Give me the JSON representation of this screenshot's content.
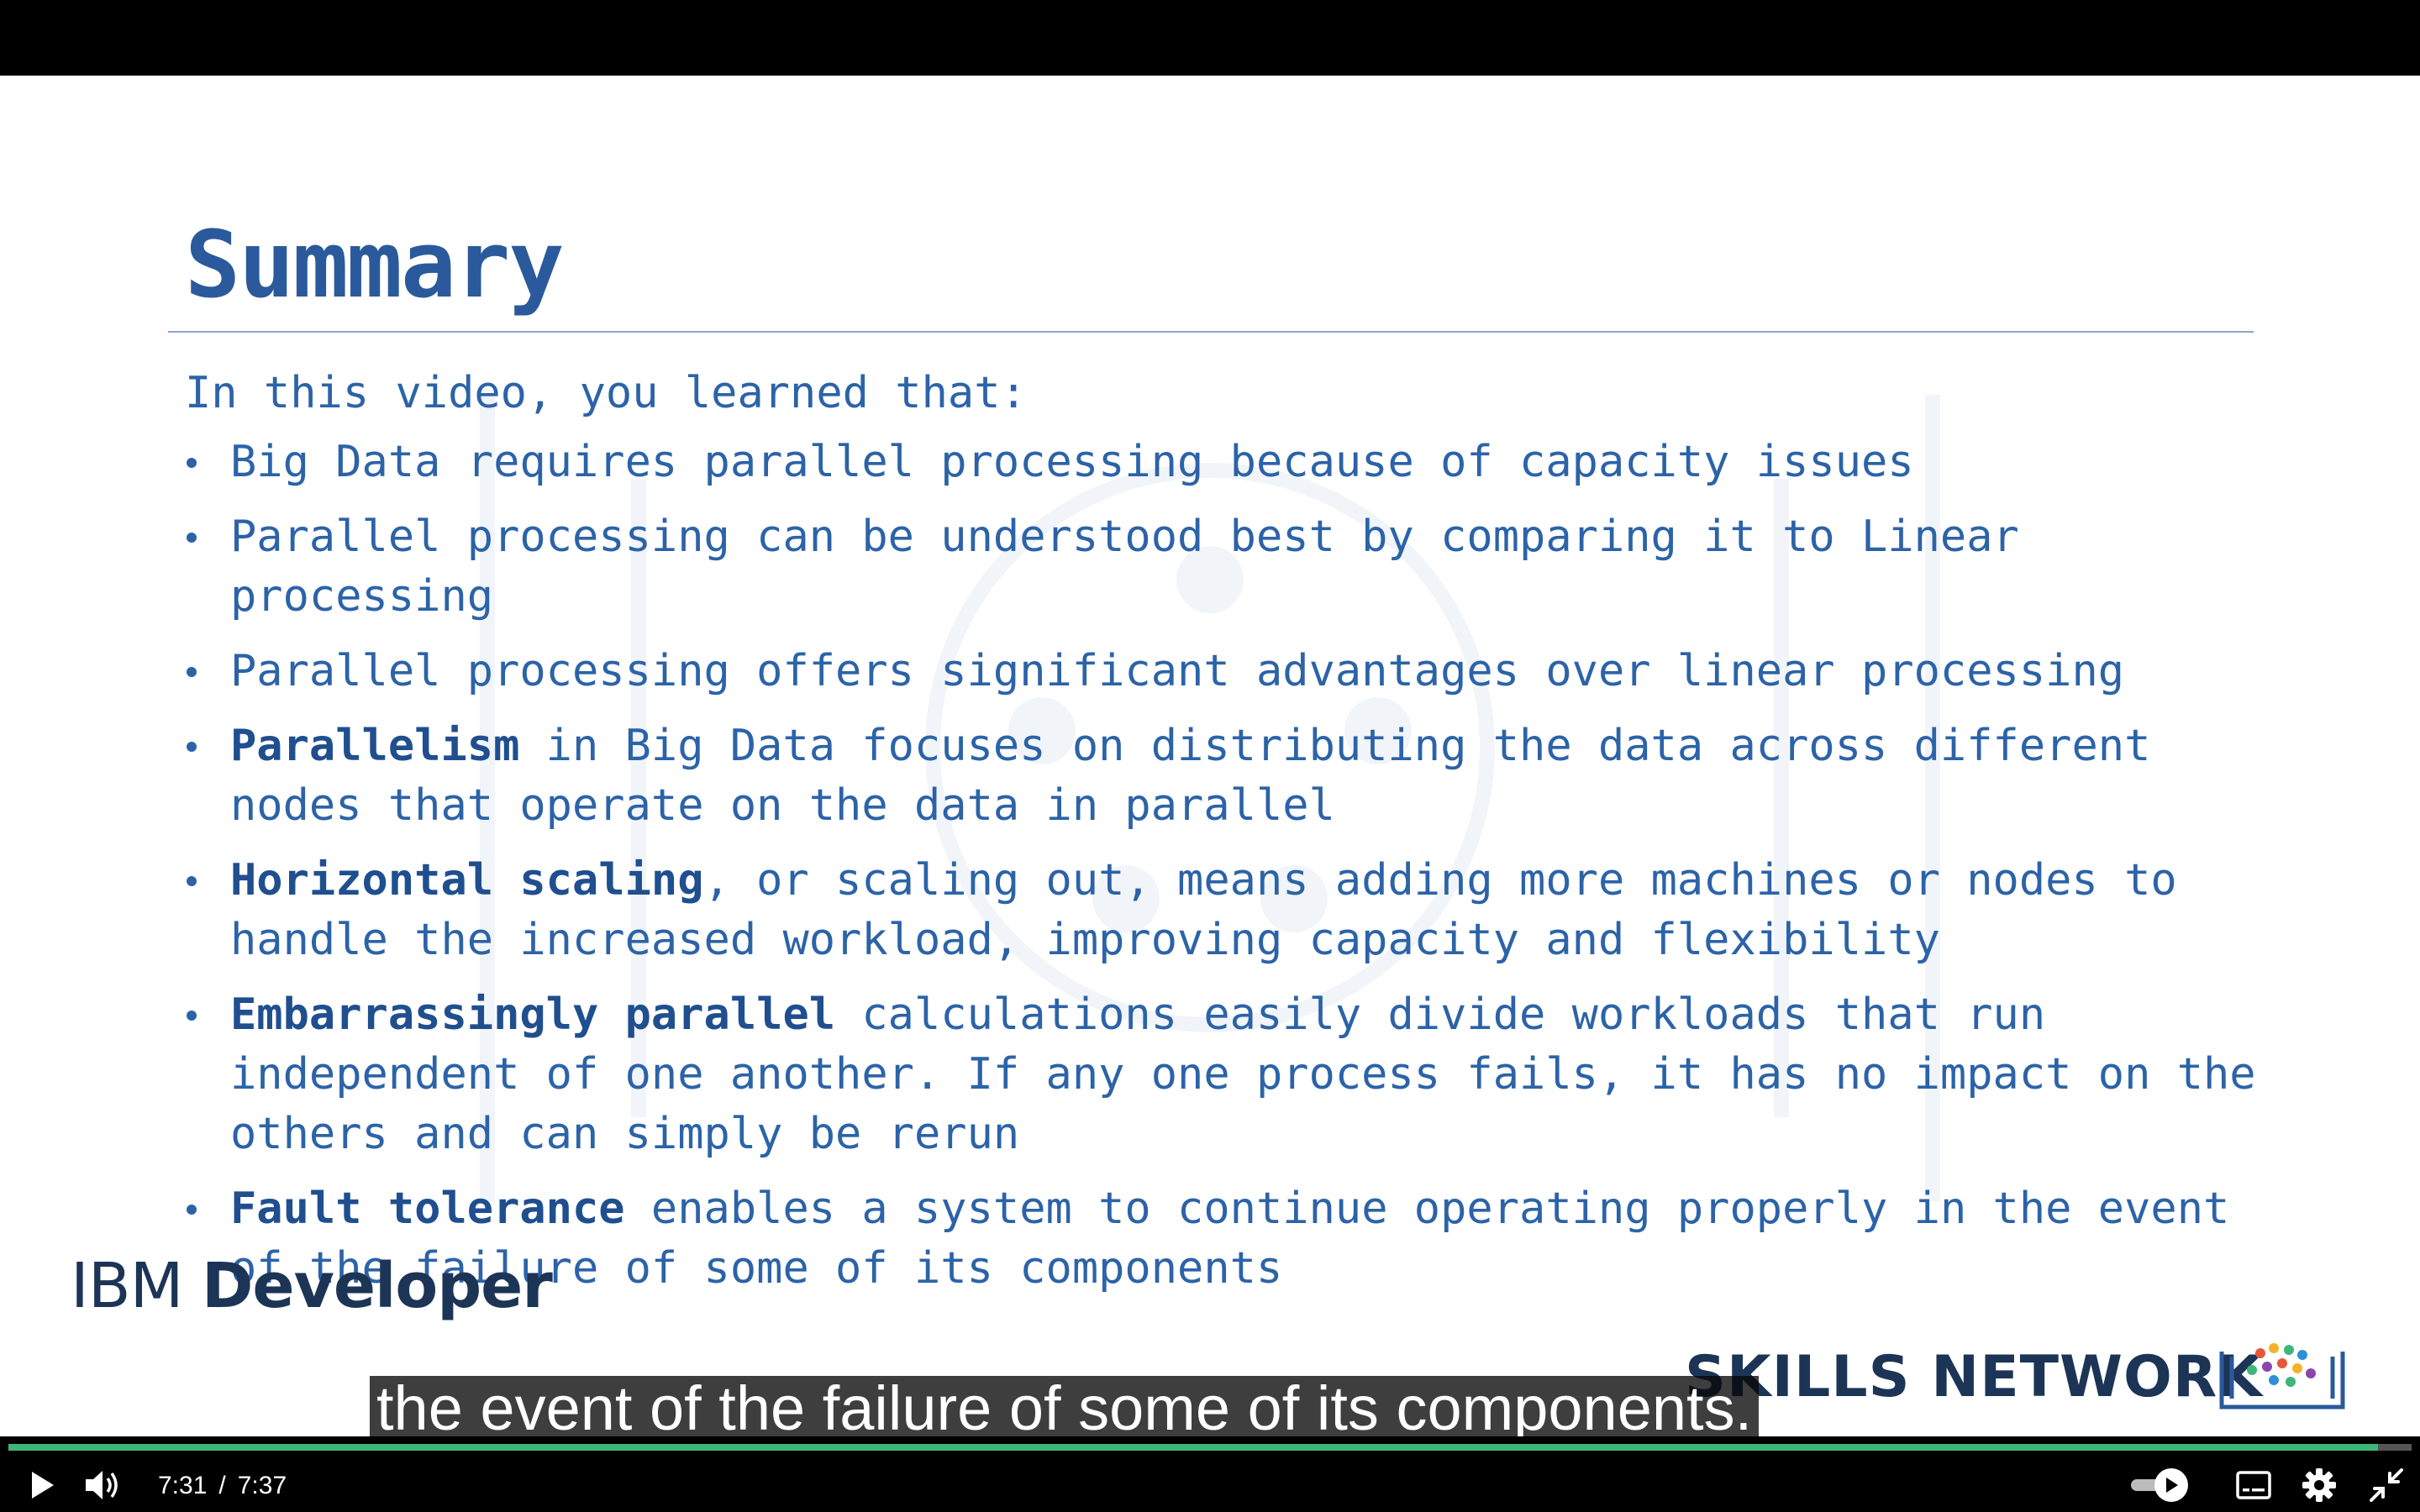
{
  "slide": {
    "title": "Summary",
    "intro": "In this video, you learned that:",
    "bullets": [
      {
        "bold": "",
        "text": "Big Data requires parallel processing because of capacity issues"
      },
      {
        "bold": "",
        "text": "Parallel processing can be understood best by comparing it to Linear processing"
      },
      {
        "bold": "",
        "text": "Parallel processing offers significant advantages over linear processing"
      },
      {
        "bold": "Parallelism",
        "text": " in Big Data focuses on distributing the data across different nodes that operate on the data in parallel"
      },
      {
        "bold": "Horizontal scaling",
        "text": ", or scaling out, means adding more machines or nodes to handle the increased workload, improving capacity and flexibility"
      },
      {
        "bold": "Embarrassingly parallel",
        "text": " calculations easily divide workloads that run independent of one another. If any one process fails, it has no impact on the others and can simply be rerun"
      },
      {
        "bold": "Fault tolerance",
        "text": " enables a system to continue operating properly in the event of the failure of some of its components"
      }
    ],
    "footer_left_light": "IBM ",
    "footer_left_bold": "Developer",
    "footer_right": "SKILLS NETWORK"
  },
  "caption": "the event of the failure of some of its components.",
  "player": {
    "current_time": "7:31",
    "separator": "/",
    "duration": "7:37",
    "progress_fraction": 0.986,
    "autoplay_on": true,
    "colors": {
      "progress": "#3fb57a",
      "title": "#2a5a9b",
      "text": "#2c63a8"
    }
  },
  "icons": [
    "play-icon",
    "volume-icon",
    "autoplay-toggle-icon",
    "subtitles-icon",
    "settings-gear-icon",
    "exit-fullscreen-icon"
  ]
}
